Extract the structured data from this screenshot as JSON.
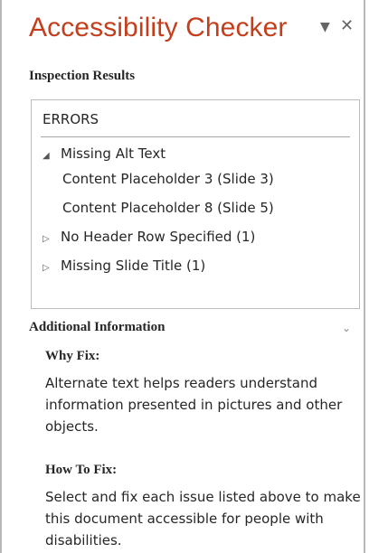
{
  "pane": {
    "title": "Accessibility Checker",
    "dropdown_icon": "▼",
    "close_icon": "✕"
  },
  "inspection": {
    "heading": "Inspection Results",
    "group": "ERRORS",
    "items": [
      {
        "label": "Missing Alt Text",
        "expanded": true,
        "arrow": "◢"
      },
      {
        "label": "Content Placeholder 3  (Slide 3)"
      },
      {
        "label": "Content Placeholder 8  (Slide 5)"
      },
      {
        "label": "No Header Row Specified (1)",
        "expanded": false,
        "arrow": "▷"
      },
      {
        "label": "Missing Slide Title (1)",
        "expanded": false,
        "arrow": "▷"
      }
    ]
  },
  "additional": {
    "heading": "Additional Information",
    "collapse_icon": "⌄",
    "why_heading": "Why Fix:",
    "why_text": "Alternate text helps readers understand information presented in pictures and other objects.",
    "how_heading": "How To Fix:",
    "how_text": "Select and fix each issue listed above to make this document accessible for people with disabilities."
  },
  "colors": {
    "title": "#c43e1c",
    "border": "#b7b7b7",
    "text": "#262626"
  }
}
